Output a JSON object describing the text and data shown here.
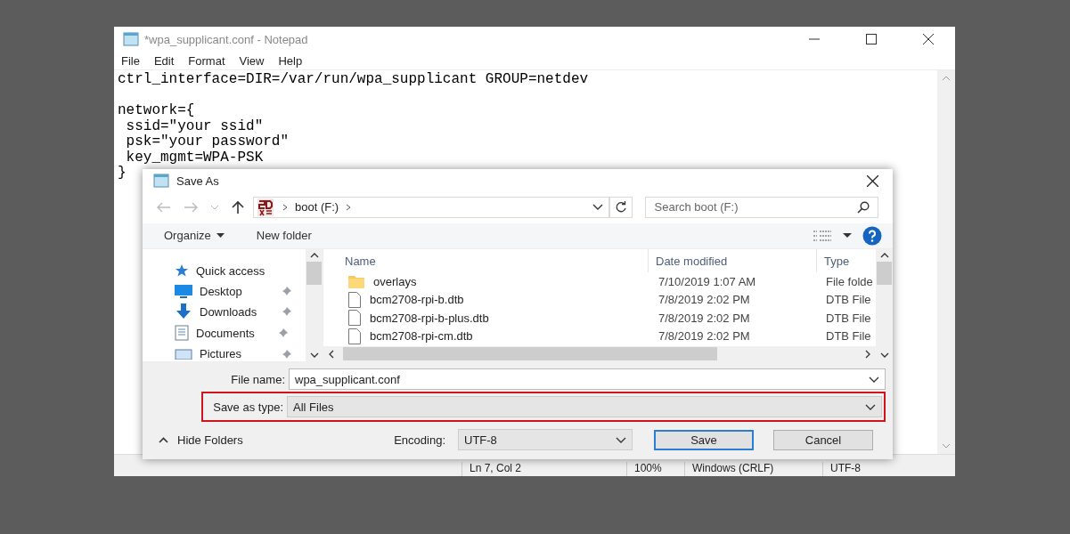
{
  "notepad": {
    "title": "*wpa_supplicant.conf - Notepad",
    "menu": [
      "File",
      "Edit",
      "Format",
      "View",
      "Help"
    ],
    "paragraphs": [
      [
        "ctrl_interface=DIR=/var/run/wpa_supplicant GROUP=netdev"
      ],
      [
        "network={",
        " ssid=\"your ssid\"",
        " psk=\"your password\"",
        " key_mgmt=WPA-PSK",
        "}"
      ]
    ],
    "status_bar": [
      "Ln 7, Col 2",
      "100%",
      "Windows (CRLF)",
      "UTF-8"
    ]
  },
  "dialog": {
    "title": "Save As",
    "address": [
      "boot (F:)"
    ],
    "search": {
      "placeholder": "Search boot (F:)"
    },
    "toolbar": [
      "Organize",
      "New folder"
    ],
    "nav": [
      {
        "kind": "star",
        "label": "Quick access",
        "pinned": false
      },
      {
        "kind": "desktop",
        "label": "Desktop",
        "pinned": true
      },
      {
        "kind": "downloads",
        "label": "Downloads",
        "pinned": true
      },
      {
        "kind": "documents",
        "label": "Documents",
        "pinned": true
      },
      {
        "kind": "pictures",
        "label": "Pictures",
        "pinned": true
      }
    ],
    "columns": [
      "Name",
      "Date modified",
      "Type"
    ],
    "files": [
      {
        "kind": "folder",
        "name": "overlays",
        "date": "7/10/2019 1:07 AM",
        "type": "File folde"
      },
      {
        "kind": "file",
        "name": "bcm2708-rpi-b.dtb",
        "date": "7/8/2019 2:02 PM",
        "type": "DTB File"
      },
      {
        "kind": "file",
        "name": "bcm2708-rpi-b-plus.dtb",
        "date": "7/8/2019 2:02 PM",
        "type": "DTB File"
      },
      {
        "kind": "file",
        "name": "bcm2708-rpi-cm.dtb",
        "date": "7/8/2019 2:02 PM",
        "type": "DTB File"
      }
    ],
    "file_name": {
      "label": "File name:",
      "value": "wpa_supplicant.conf"
    },
    "save_type": {
      "label": "Save as type:",
      "value": "All Files",
      "highlighted": true
    },
    "hide_folders": "Hide Folders",
    "encoding": {
      "label": "Encoding:",
      "value": "UTF-8"
    },
    "buttons": [
      "Save",
      "Cancel"
    ]
  }
}
